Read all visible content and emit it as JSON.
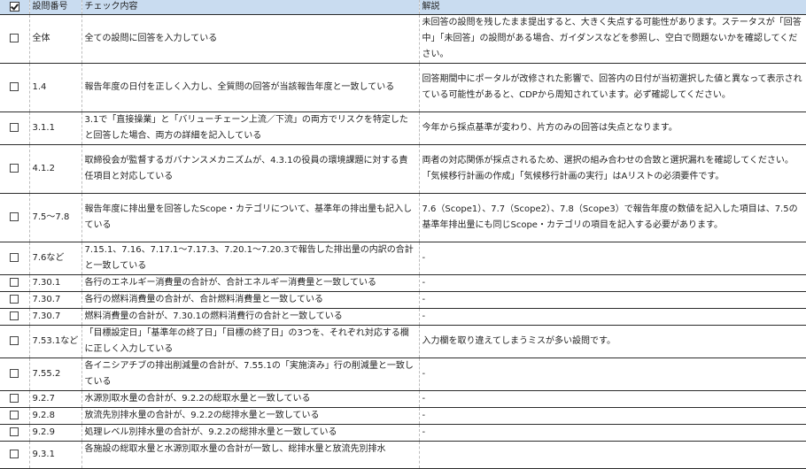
{
  "header": {
    "check": "☑",
    "number": "設問番号",
    "content": "チェック内容",
    "explanation": "解説"
  },
  "rows": [
    {
      "check": "☐",
      "number": "全体",
      "content": "全ての設問に回答を入力している",
      "explanation": "未回答の設問を残したまま提出すると、大きく失点する可能性があります。ステータスが「回答中」「未回答」の設問がある場合、ガイダンスなどを参照し、空白で問題ないかを確認してください。"
    },
    {
      "check": "☐",
      "number": "1.4",
      "content": "報告年度の日付を正しく入力し、全質問の回答が当該報告年度と一致している",
      "explanation": "回答期間中にポータルが改修された影響で、回答内の日付が当初選択した値と異なって表示されている可能性があると、CDPから周知されています。必ず確認してください。"
    },
    {
      "check": "☐",
      "number": "3.1.1",
      "content": "3.1で「直接操業」と「バリューチェーン上流／下流」の両方でリスクを特定したと回答した場合、両方の詳細を記入している",
      "explanation": "今年から採点基準が変わり、片方のみの回答は失点となります。"
    },
    {
      "check": "☐",
      "number": "4.1.2",
      "content": "取締役会が監督するガバナンスメカニズムが、4.3.1の役員の環境課題に対する責任項目と対応している",
      "explanation": "両者の対応関係が採点されるため、選択の組み合わせの合致と選択漏れを確認してください。「気候移行計画の作成」「気候移行計画の実行」はAリストの必須要件です。"
    },
    {
      "check": "☐",
      "number": "7.5～7.8",
      "content": "報告年度に排出量を回答したScope・カテゴリについて、基準年の排出量も記入している",
      "explanation": "7.6（Scope1）、7.7（Scope2）、7.8（Scope3）で報告年度の数値を記入した項目は、7.5の基準年排出量にも同じScope・カテゴリの項目を記入する必要があります。"
    },
    {
      "check": "☐",
      "number": "7.6など",
      "content": "7.15.1、7.16、7.17.1～7.17.3、7.20.1～7.20.3で報告した排出量の内訳の合計と一致している",
      "explanation": "-"
    },
    {
      "check": "☐",
      "number": "7.30.1",
      "content": "各行のエネルギー消費量の合計が、合計エネルギー消費量と一致している",
      "explanation": "-"
    },
    {
      "check": "☐",
      "number": "7.30.7",
      "content": "各行の燃料消費量の合計が、合計燃料消費量と一致している",
      "explanation": "-"
    },
    {
      "check": "☐",
      "number": "7.30.7",
      "content": "燃料消費量の合計が、7.30.1の燃料消費行の合計と一致している",
      "explanation": "-"
    },
    {
      "check": "☐",
      "number": "7.53.1など",
      "content": "「目標設定日」「基準年の終了日」「目標の終了日」の3つを、それぞれ対応する欄に正しく入力している",
      "explanation": "入力欄を取り違えてしまうミスが多い設問です。"
    },
    {
      "check": "☐",
      "number": "7.55.2",
      "content": "各イニシアチブの排出削減量の合計が、7.55.1の「実施済み」行の削減量と一致している",
      "explanation": "-"
    },
    {
      "check": "☐",
      "number": "9.2.7",
      "content": "水源別取水量の合計が、9.2.2の総取水量と一致している",
      "explanation": "-"
    },
    {
      "check": "☐",
      "number": "9.2.8",
      "content": "放流先別排水量の合計が、9.2.2の総排水量と一致している",
      "explanation": "-"
    },
    {
      "check": "☐",
      "number": "9.2.9",
      "content": "処理レベル別排水量の合計が、9.2.2の総排水量と一致している",
      "explanation": "-"
    },
    {
      "check": "☐",
      "number": "9.3.1",
      "content": "各施設の総取水量と水源別取水量の合計が一致し、総排水量と放流先別排水",
      "explanation": ""
    }
  ]
}
